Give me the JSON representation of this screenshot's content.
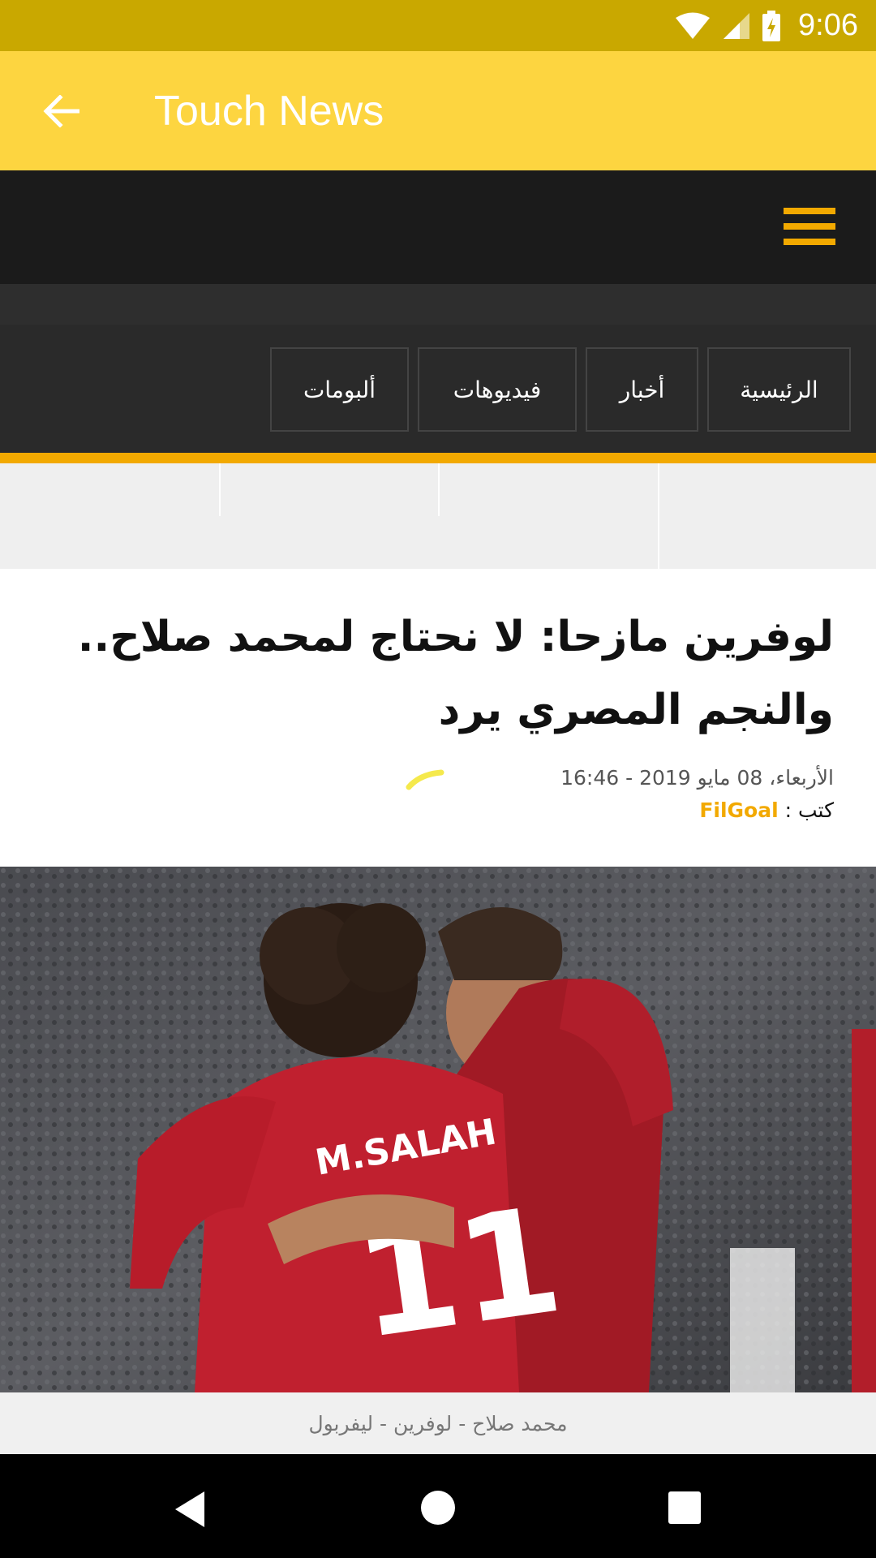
{
  "status_bar": {
    "time": "9:06"
  },
  "app_bar": {
    "title": "Touch News"
  },
  "nav": {
    "items": [
      {
        "label": "الرئيسية"
      },
      {
        "label": "أخبار"
      },
      {
        "label": "فيديوهات"
      },
      {
        "label": "ألبومات"
      }
    ]
  },
  "article": {
    "title": "لوفرين مازحا: لا نحتاج لمحمد صلاح.. والنجم المصري يرد",
    "date": "الأربعاء، 08 مايو 2019 - 16:46",
    "author_prefix": "كتب :",
    "author": "FilGoal",
    "image": {
      "jersey_text": "M.SALAH",
      "jersey_number": "11"
    },
    "caption": "محمد صلاح - لوفرين - ليفربول"
  },
  "colors": {
    "status_bar": "#c9a800",
    "app_bar": "#fdd540",
    "accent": "#f2a900",
    "header": "#1b1b1b"
  },
  "icons": [
    "wifi-icon",
    "signal-icon",
    "battery-charging-icon",
    "back-arrow-icon",
    "hamburger-menu-icon",
    "nav-back-icon",
    "nav-home-icon",
    "nav-recents-icon"
  ]
}
